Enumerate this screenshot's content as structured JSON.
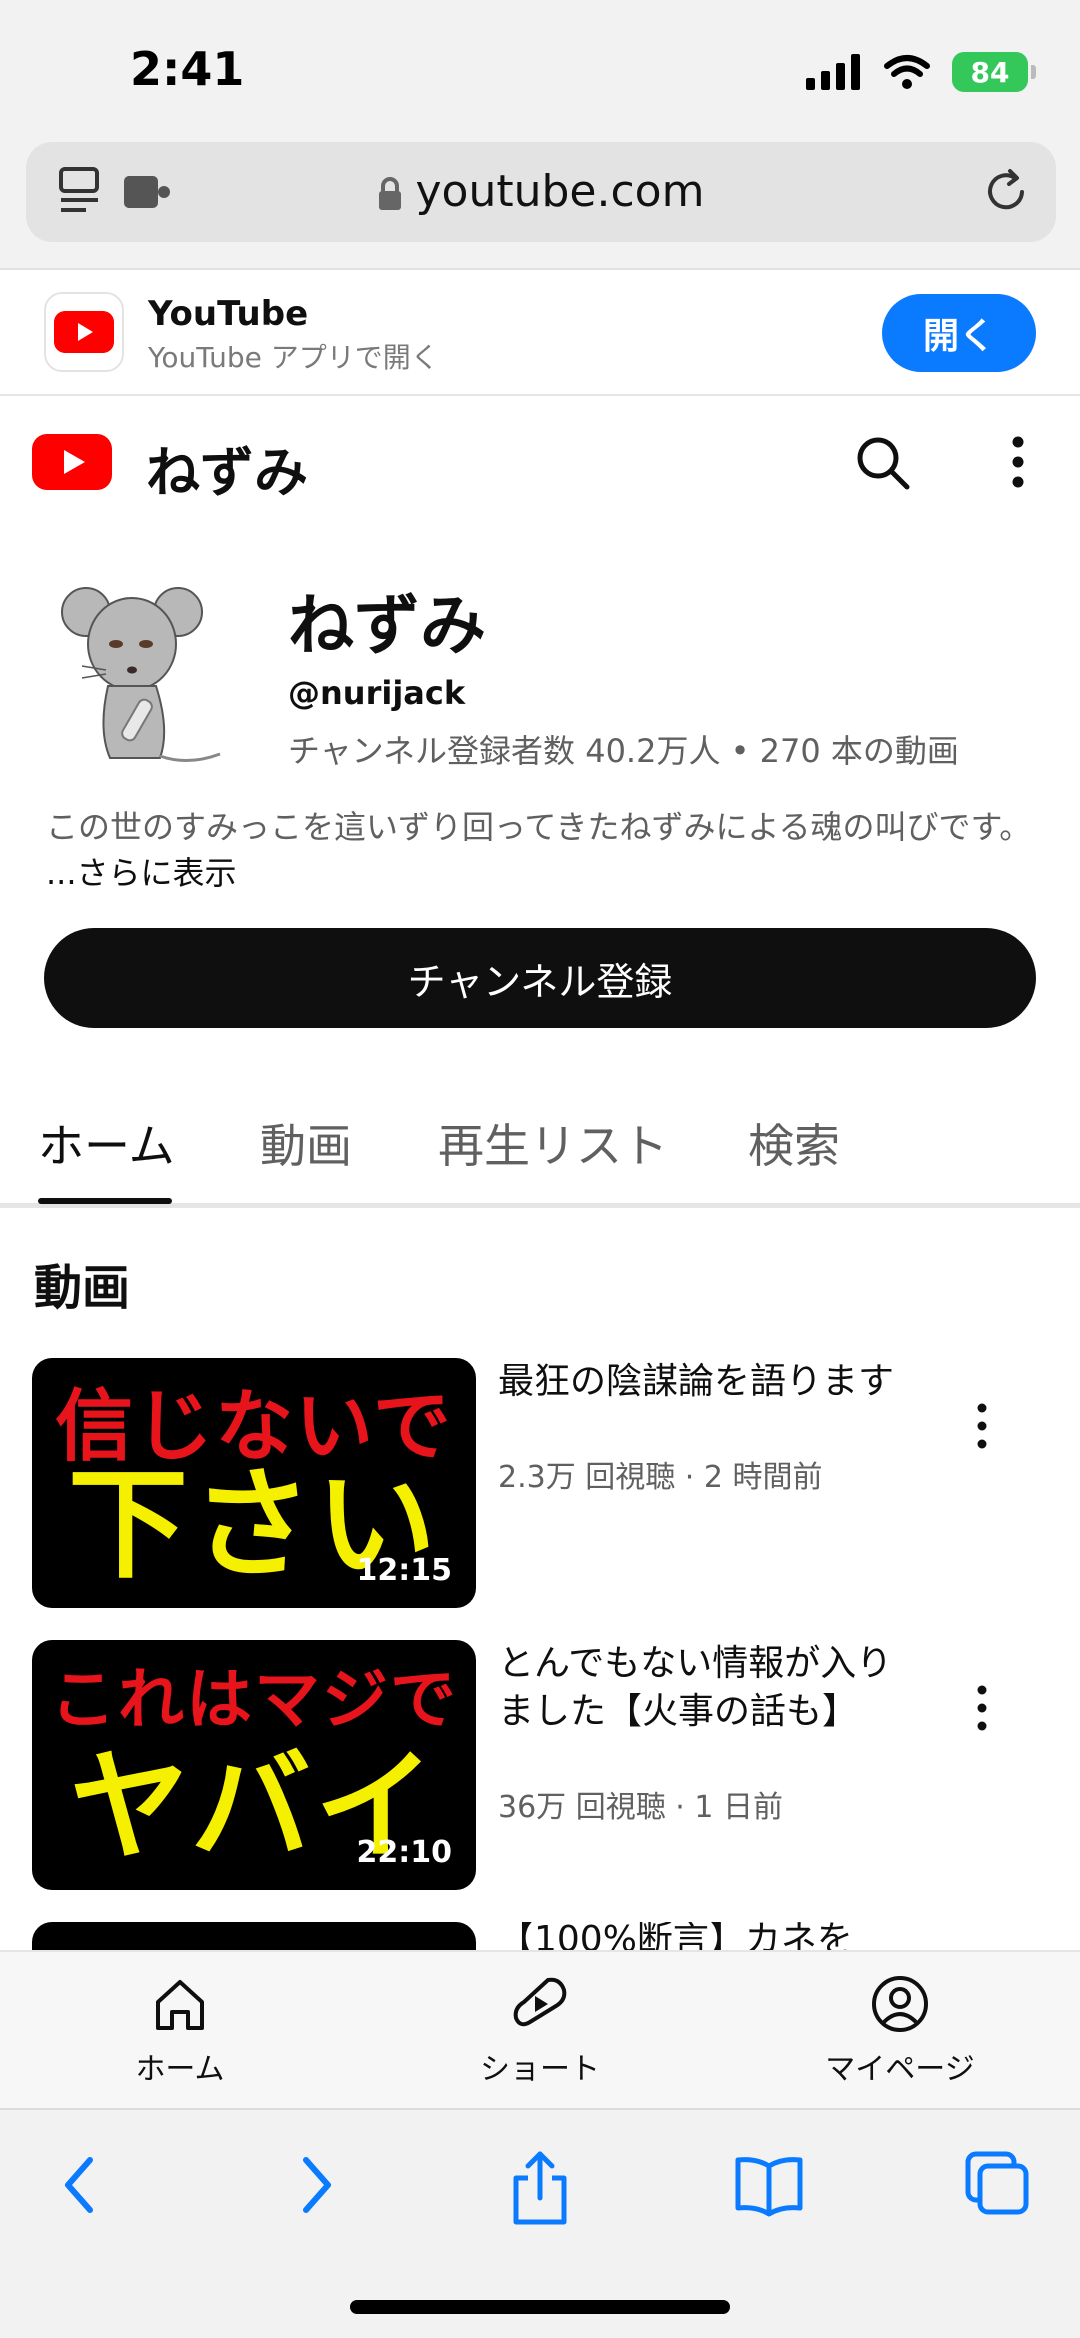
{
  "status": {
    "time": "2:41",
    "battery": "84"
  },
  "browser": {
    "url": "youtube.com"
  },
  "app_banner": {
    "name": "YouTube",
    "subtitle": "YouTube アプリで開く",
    "open_label": "開く"
  },
  "header": {
    "title": "ねずみ"
  },
  "channel": {
    "name": "ねずみ",
    "handle": "@nurijack",
    "stats": "チャンネル登録者数 40.2万人 • 270 本の動画",
    "description": "この世のすみっこを這いずり回ってきたねずみによる魂の叫びです。",
    "more_label": "...さらに表示",
    "subscribe_label": "チャンネル登録"
  },
  "tabs": [
    {
      "label": "ホーム",
      "active": true
    },
    {
      "label": "動画"
    },
    {
      "label": "再生リスト"
    },
    {
      "label": "検索"
    }
  ],
  "section_title": "動画",
  "videos": [
    {
      "thumb_line1": "信じないで",
      "thumb_line2": "下さい",
      "duration": "12:15",
      "title": "最狂の陰謀論を語ります",
      "meta": "2.3万 回視聴 · 2 時間前"
    },
    {
      "thumb_line1": "これはマジで",
      "thumb_line2": "ヤバイ",
      "duration": "22:10",
      "title": "とんでもない情報が入りました【火事の話も】",
      "meta": "36万 回視聴 · 1 日前"
    },
    {
      "title": "【100%断言】カネを"
    }
  ],
  "bottom_nav": [
    {
      "label": "ホーム",
      "icon": "home-icon"
    },
    {
      "label": "ショート",
      "icon": "shorts-icon"
    },
    {
      "label": "マイページ",
      "icon": "profile-icon"
    }
  ],
  "colors": {
    "youtube_red": "#ff0000",
    "accent_blue": "#0a7aff",
    "thumb_red": "#e8141c",
    "thumb_yellow": "#f4f000"
  }
}
